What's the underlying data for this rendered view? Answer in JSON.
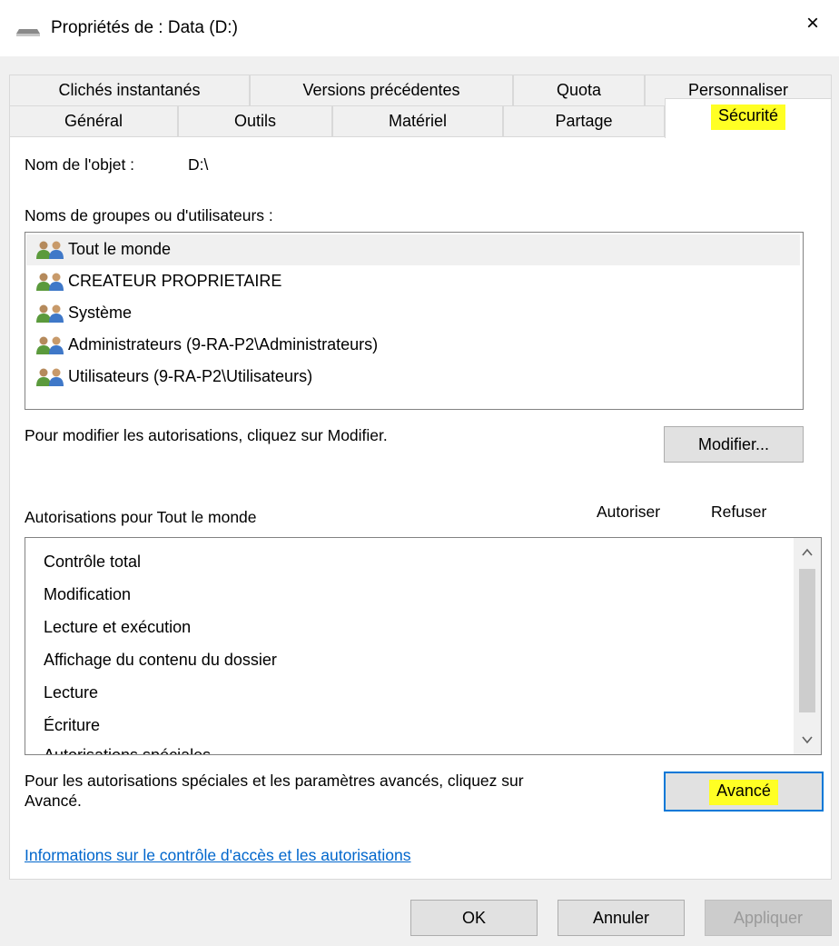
{
  "window": {
    "title": "Propriétés de : Data (D:)",
    "close_label": "×"
  },
  "tabs": {
    "row1": [
      "Clichés instantanés",
      "Versions précédentes",
      "Quota",
      "Personnaliser"
    ],
    "row2": [
      "Général",
      "Outils",
      "Matériel",
      "Partage",
      "Sécurité"
    ],
    "active": "Sécurité"
  },
  "security": {
    "object_name_label": "Nom de l'objet :",
    "object_name_value": "D:\\",
    "groups_label": "Noms de groupes ou d'utilisateurs :",
    "groups": [
      "Tout le monde",
      "CREATEUR PROPRIETAIRE",
      "Système",
      "Administrateurs (9-RA-P2\\Administrateurs)",
      "Utilisateurs (9-RA-P2\\Utilisateurs)"
    ],
    "selected_group": "Tout le monde",
    "modify_hint": "Pour modifier les autorisations, cliquez sur Modifier.",
    "modify_button": "Modifier...",
    "permissions_label": "Autorisations pour Tout le monde",
    "allow_header": "Autoriser",
    "deny_header": "Refuser",
    "permissions": [
      "Contrôle total",
      "Modification",
      "Lecture et exécution",
      "Affichage du contenu du dossier",
      "Lecture",
      "Écriture",
      "Autorisations spéciales"
    ],
    "advanced_hint_line1": "Pour les autorisations spéciales et les paramètres avancés, cliquez sur",
    "advanced_hint_line2": "Avancé.",
    "advanced_button": "Avancé",
    "info_link": "Informations sur le contrôle d'accès et les autorisations"
  },
  "footer": {
    "ok": "OK",
    "cancel": "Annuler",
    "apply": "Appliquer"
  },
  "colors": {
    "highlight": "#ffff24",
    "link": "#0066cc",
    "focus_border": "#0078d7"
  }
}
